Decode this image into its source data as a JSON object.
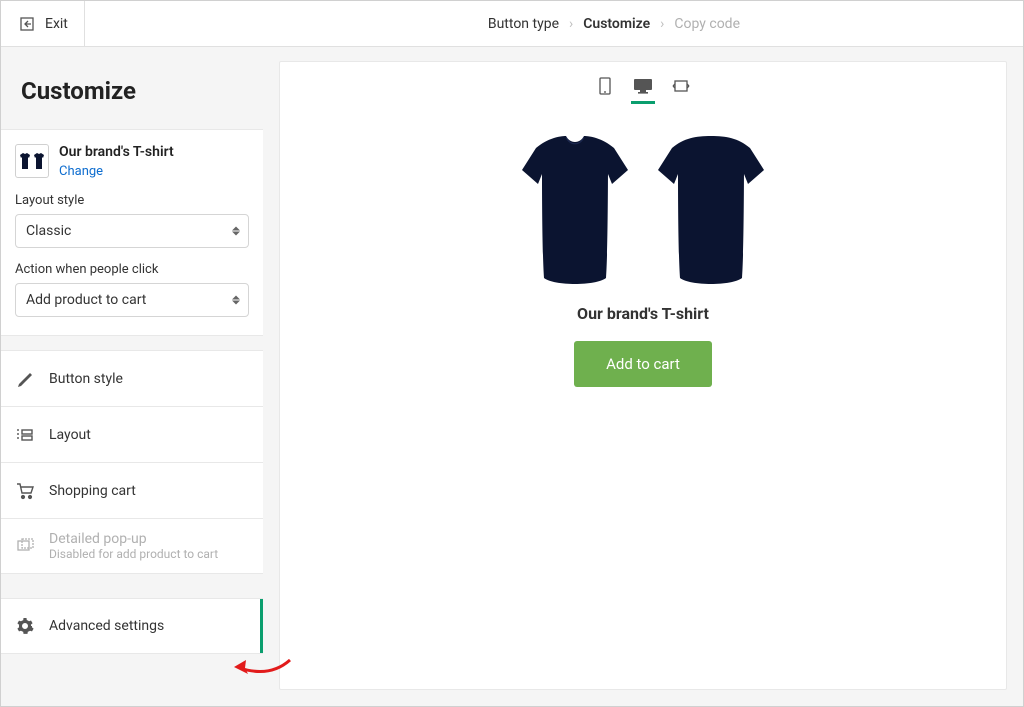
{
  "topbar": {
    "exit": "Exit"
  },
  "breadcrumb": {
    "step1": "Button type",
    "step2": "Customize",
    "step3": "Copy code"
  },
  "sidebar": {
    "title": "Customize",
    "product": {
      "name": "Our brand's T-shirt",
      "change": "Change"
    },
    "layout_label": "Layout style",
    "layout_value": "Classic",
    "action_label": "Action when people click",
    "action_value": "Add product to cart",
    "menu": {
      "button_style": "Button style",
      "layout": "Layout",
      "shopping_cart": "Shopping cart",
      "detailed_popup": "Detailed pop-up",
      "detailed_popup_sub": "Disabled for add product to cart",
      "advanced": "Advanced settings"
    }
  },
  "preview": {
    "product_title": "Our brand's T-shirt",
    "cta": "Add to cart"
  }
}
